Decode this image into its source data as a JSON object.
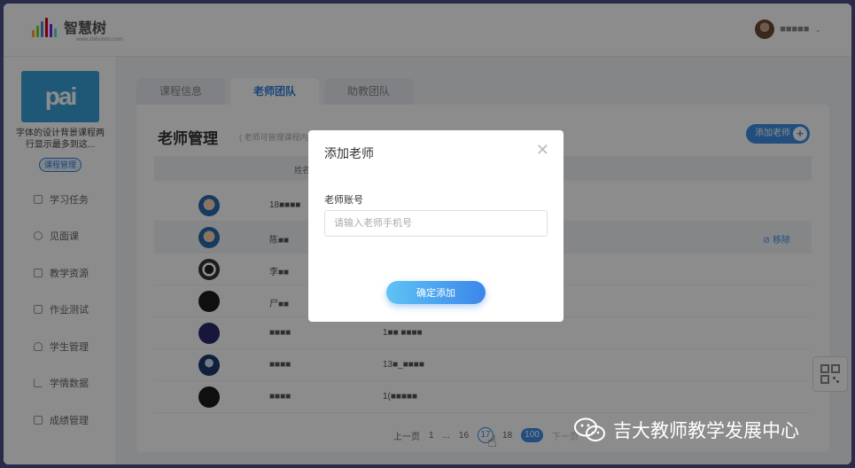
{
  "header": {
    "logo_text": "智慧树",
    "logo_sub": "www.zhihuishu.com",
    "user_name": "■■■■■"
  },
  "sidebar": {
    "course_thumb_text": "pai",
    "course_title": "字体的设计背景课程两行显示最多到这...",
    "course_tag": "课程管理",
    "items": [
      {
        "label": "学习任务",
        "icon": "task-icon"
      },
      {
        "label": "见面课",
        "icon": "person-icon"
      },
      {
        "label": "教学资源",
        "icon": "resource-icon"
      },
      {
        "label": "作业测试",
        "icon": "homework-icon"
      },
      {
        "label": "学生管理",
        "icon": "student-icon"
      },
      {
        "label": "学情数据",
        "icon": "chart-icon"
      },
      {
        "label": "成绩管理",
        "icon": "grade-icon"
      }
    ]
  },
  "tabs": [
    {
      "label": "课程信息",
      "active": false
    },
    {
      "label": "老师团队",
      "active": true
    },
    {
      "label": "助教团队",
      "active": false
    }
  ],
  "panel": {
    "title": "老师管理",
    "subtitle": "( 老师可管理课程内所有",
    "add_button": "添加老师",
    "column_name": "姓名",
    "remove_label": "移除",
    "rows": [
      {
        "name": "18■■■■",
        "phone": ""
      },
      {
        "name": "陈■■",
        "phone": ""
      },
      {
        "name": "李■■",
        "phone": ""
      },
      {
        "name": "尸■■",
        "phone": ""
      },
      {
        "name": "■■■■",
        "phone": "1■■ ■■■■"
      },
      {
        "name": "■■■■",
        "phone": "13■_■■■■"
      },
      {
        "name": "■■■■",
        "phone": "1(■■■■■"
      }
    ]
  },
  "pager": {
    "prev": "上一页",
    "pages": [
      "1",
      "...",
      "16",
      "17",
      "18",
      "100"
    ],
    "current": "17",
    "next": "下一页"
  },
  "modal": {
    "title": "添加老师",
    "field_label": "老师账号",
    "field_placeholder": "请输入老师手机号",
    "field_value": "",
    "confirm_button": "确定添加"
  },
  "watermark": "吉大教师教学发展中心",
  "colors": {
    "accent": "#3d8fe8",
    "overlay": "rgba(0,0,0,0.45)"
  }
}
